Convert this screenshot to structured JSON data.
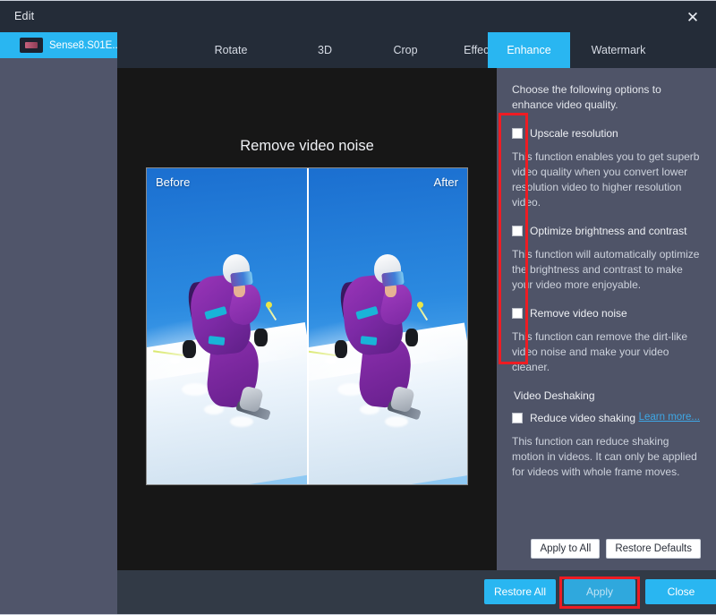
{
  "window": {
    "title": "Edit",
    "close_icon": "close-icon"
  },
  "sidebar": {
    "files": [
      {
        "label": "Sense8.S01E...",
        "thumb_icon": "video-thumbnail-icon"
      }
    ]
  },
  "tabs": [
    {
      "label": "Rotate",
      "active": false
    },
    {
      "label": "3D",
      "active": false
    },
    {
      "label": "Crop",
      "active": false
    },
    {
      "label": "Effect",
      "active": false
    },
    {
      "label": "Enhance",
      "active": true
    },
    {
      "label": "Watermark",
      "active": false
    }
  ],
  "preview": {
    "title": "Remove video noise",
    "before_label": "Before",
    "after_label": "After"
  },
  "options": {
    "intro": "Choose the following options to enhance video quality.",
    "items": [
      {
        "label": "Upscale resolution",
        "checked": false,
        "description": "This function enables you to get superb video quality when you convert lower resolution video to higher resolution video."
      },
      {
        "label": "Optimize brightness and contrast",
        "checked": false,
        "description": "This function will automatically optimize the brightness and contrast to make your video more enjoyable."
      },
      {
        "label": "Remove video noise",
        "checked": false,
        "description": "This function can remove the dirt-like video noise and make your video cleaner."
      }
    ],
    "section_title": "Video Deshaking",
    "deshake": {
      "label": "Reduce video shaking",
      "checked": false,
      "description": "This function can reduce shaking motion in videos. It can only be applied for videos with whole frame moves."
    },
    "learn_more": "Learn more...",
    "apply_to_all": "Apply to All",
    "restore_defaults": "Restore Defaults"
  },
  "footer": {
    "restore_all": "Restore All",
    "apply": "Apply",
    "close": "Close"
  },
  "annotations": {
    "color": "#ee1c23",
    "boxes": [
      "checkbox-column-highlight",
      "apply-button-highlight"
    ]
  },
  "colors": {
    "accent": "#29b6f1",
    "panel": "#4f5468",
    "titlebar": "#242c38",
    "stage": "#171717",
    "bottombar": "#323a46",
    "annotation": "#ee1c23"
  }
}
